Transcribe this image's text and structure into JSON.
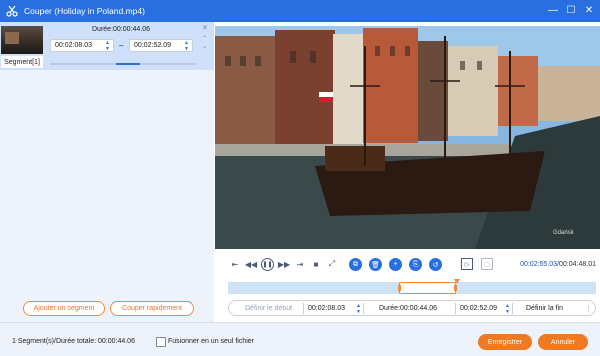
{
  "window": {
    "title": "Couper (Holiday in Poland.mp4)"
  },
  "segment": {
    "label": "Segment[1]",
    "duration": "Durée:00:00:44.06",
    "start": "00:02:08.03",
    "end": "00:02:52.09",
    "separator": "–",
    "progress_fraction": 0.55
  },
  "left_buttons": {
    "add_segment": "Ajouter un segment",
    "quick_cut": "Couper rapidement"
  },
  "player": {
    "current_time": "00:02:55.03",
    "total_time": "00:04:48.01",
    "time_separator": "/",
    "watermark": "Gdańsk"
  },
  "trim_bar": {
    "set_start": "Définir le début",
    "start": "00:02:08.03",
    "duration": "Durée:00:00:44.06",
    "end": "00:02:52.09",
    "set_end": "Définir la fin"
  },
  "footer": {
    "status": "1 Segment(s)/Durée totale: 00:00:44.06",
    "merge_label": "Fusionner en un seul fichier",
    "merge_checked": false,
    "save": "Enregistrer",
    "cancel": "Annuler"
  },
  "colors": {
    "accent": "#2a6fe0",
    "orange": "#f07a22"
  }
}
